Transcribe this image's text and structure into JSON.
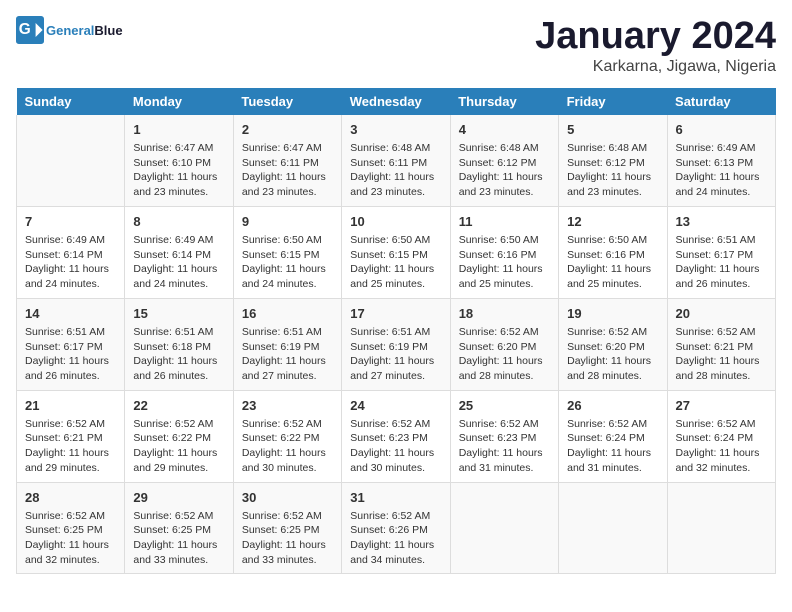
{
  "logo": {
    "text_general": "General",
    "text_blue": "Blue"
  },
  "title": "January 2024",
  "location": "Karkarna, Jigawa, Nigeria",
  "days_of_week": [
    "Sunday",
    "Monday",
    "Tuesday",
    "Wednesday",
    "Thursday",
    "Friday",
    "Saturday"
  ],
  "weeks": [
    [
      {
        "day": "",
        "info": ""
      },
      {
        "day": "1",
        "info": "Sunrise: 6:47 AM\nSunset: 6:10 PM\nDaylight: 11 hours\nand 23 minutes."
      },
      {
        "day": "2",
        "info": "Sunrise: 6:47 AM\nSunset: 6:11 PM\nDaylight: 11 hours\nand 23 minutes."
      },
      {
        "day": "3",
        "info": "Sunrise: 6:48 AM\nSunset: 6:11 PM\nDaylight: 11 hours\nand 23 minutes."
      },
      {
        "day": "4",
        "info": "Sunrise: 6:48 AM\nSunset: 6:12 PM\nDaylight: 11 hours\nand 23 minutes."
      },
      {
        "day": "5",
        "info": "Sunrise: 6:48 AM\nSunset: 6:12 PM\nDaylight: 11 hours\nand 23 minutes."
      },
      {
        "day": "6",
        "info": "Sunrise: 6:49 AM\nSunset: 6:13 PM\nDaylight: 11 hours\nand 24 minutes."
      }
    ],
    [
      {
        "day": "7",
        "info": "Sunrise: 6:49 AM\nSunset: 6:14 PM\nDaylight: 11 hours\nand 24 minutes."
      },
      {
        "day": "8",
        "info": "Sunrise: 6:49 AM\nSunset: 6:14 PM\nDaylight: 11 hours\nand 24 minutes."
      },
      {
        "day": "9",
        "info": "Sunrise: 6:50 AM\nSunset: 6:15 PM\nDaylight: 11 hours\nand 24 minutes."
      },
      {
        "day": "10",
        "info": "Sunrise: 6:50 AM\nSunset: 6:15 PM\nDaylight: 11 hours\nand 25 minutes."
      },
      {
        "day": "11",
        "info": "Sunrise: 6:50 AM\nSunset: 6:16 PM\nDaylight: 11 hours\nand 25 minutes."
      },
      {
        "day": "12",
        "info": "Sunrise: 6:50 AM\nSunset: 6:16 PM\nDaylight: 11 hours\nand 25 minutes."
      },
      {
        "day": "13",
        "info": "Sunrise: 6:51 AM\nSunset: 6:17 PM\nDaylight: 11 hours\nand 26 minutes."
      }
    ],
    [
      {
        "day": "14",
        "info": "Sunrise: 6:51 AM\nSunset: 6:17 PM\nDaylight: 11 hours\nand 26 minutes."
      },
      {
        "day": "15",
        "info": "Sunrise: 6:51 AM\nSunset: 6:18 PM\nDaylight: 11 hours\nand 26 minutes."
      },
      {
        "day": "16",
        "info": "Sunrise: 6:51 AM\nSunset: 6:19 PM\nDaylight: 11 hours\nand 27 minutes."
      },
      {
        "day": "17",
        "info": "Sunrise: 6:51 AM\nSunset: 6:19 PM\nDaylight: 11 hours\nand 27 minutes."
      },
      {
        "day": "18",
        "info": "Sunrise: 6:52 AM\nSunset: 6:20 PM\nDaylight: 11 hours\nand 28 minutes."
      },
      {
        "day": "19",
        "info": "Sunrise: 6:52 AM\nSunset: 6:20 PM\nDaylight: 11 hours\nand 28 minutes."
      },
      {
        "day": "20",
        "info": "Sunrise: 6:52 AM\nSunset: 6:21 PM\nDaylight: 11 hours\nand 28 minutes."
      }
    ],
    [
      {
        "day": "21",
        "info": "Sunrise: 6:52 AM\nSunset: 6:21 PM\nDaylight: 11 hours\nand 29 minutes."
      },
      {
        "day": "22",
        "info": "Sunrise: 6:52 AM\nSunset: 6:22 PM\nDaylight: 11 hours\nand 29 minutes."
      },
      {
        "day": "23",
        "info": "Sunrise: 6:52 AM\nSunset: 6:22 PM\nDaylight: 11 hours\nand 30 minutes."
      },
      {
        "day": "24",
        "info": "Sunrise: 6:52 AM\nSunset: 6:23 PM\nDaylight: 11 hours\nand 30 minutes."
      },
      {
        "day": "25",
        "info": "Sunrise: 6:52 AM\nSunset: 6:23 PM\nDaylight: 11 hours\nand 31 minutes."
      },
      {
        "day": "26",
        "info": "Sunrise: 6:52 AM\nSunset: 6:24 PM\nDaylight: 11 hours\nand 31 minutes."
      },
      {
        "day": "27",
        "info": "Sunrise: 6:52 AM\nSunset: 6:24 PM\nDaylight: 11 hours\nand 32 minutes."
      }
    ],
    [
      {
        "day": "28",
        "info": "Sunrise: 6:52 AM\nSunset: 6:25 PM\nDaylight: 11 hours\nand 32 minutes."
      },
      {
        "day": "29",
        "info": "Sunrise: 6:52 AM\nSunset: 6:25 PM\nDaylight: 11 hours\nand 33 minutes."
      },
      {
        "day": "30",
        "info": "Sunrise: 6:52 AM\nSunset: 6:25 PM\nDaylight: 11 hours\nand 33 minutes."
      },
      {
        "day": "31",
        "info": "Sunrise: 6:52 AM\nSunset: 6:26 PM\nDaylight: 11 hours\nand 34 minutes."
      },
      {
        "day": "",
        "info": ""
      },
      {
        "day": "",
        "info": ""
      },
      {
        "day": "",
        "info": ""
      }
    ]
  ]
}
